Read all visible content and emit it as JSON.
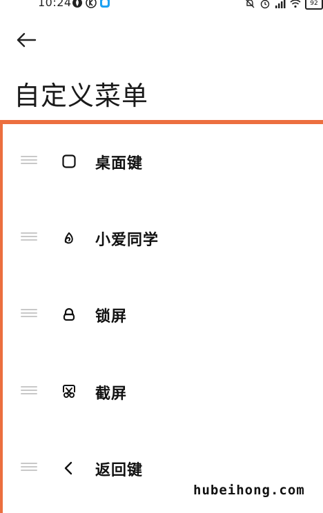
{
  "status_bar": {
    "time": "10:24",
    "battery": "92",
    "left_icons": [
      "fire-icon",
      "k-badge-icon",
      "app-badge-icon"
    ],
    "right_icons": [
      "mute-bell-icon",
      "alarm-icon",
      "signal-icon",
      "wifi-icon"
    ]
  },
  "header": {
    "back_icon": "arrow-left-icon",
    "title": "自定义菜单"
  },
  "highlight_color": "#ec6f3f",
  "menu": {
    "items": [
      {
        "label": "桌面键",
        "icon": "home-square-icon"
      },
      {
        "label": "小爱同学",
        "icon": "xiaoai-icon"
      },
      {
        "label": "锁屏",
        "icon": "lock-icon"
      },
      {
        "label": "截屏",
        "icon": "screenshot-scissors-icon"
      },
      {
        "label": "返回键",
        "icon": "back-chevron-icon"
      }
    ]
  },
  "watermark": "hubeihong.com"
}
